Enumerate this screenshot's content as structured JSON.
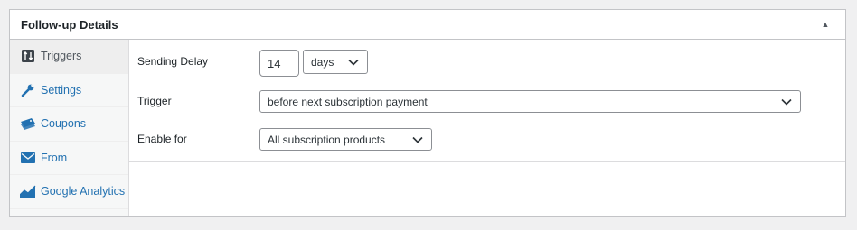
{
  "postbox": {
    "title": "Follow-up Details"
  },
  "tabs": [
    {
      "label": "Triggers",
      "icon": "triggers-icon",
      "active": true
    },
    {
      "label": "Settings",
      "icon": "wrench-icon",
      "active": false
    },
    {
      "label": "Coupons",
      "icon": "coupons-icon",
      "active": false
    },
    {
      "label": "From",
      "icon": "envelope-icon",
      "active": false
    },
    {
      "label": "Google Analytics",
      "icon": "analytics-icon",
      "active": false
    }
  ],
  "fields": {
    "sending_delay": {
      "label": "Sending Delay",
      "value": "14",
      "unit": "days"
    },
    "trigger": {
      "label": "Trigger",
      "value": "before next subscription payment"
    },
    "enable_for": {
      "label": "Enable for",
      "value": "All subscription products"
    }
  },
  "colors": {
    "link": "#2271b1",
    "border": "#c3c4c7",
    "background": "#f0f0f1"
  }
}
